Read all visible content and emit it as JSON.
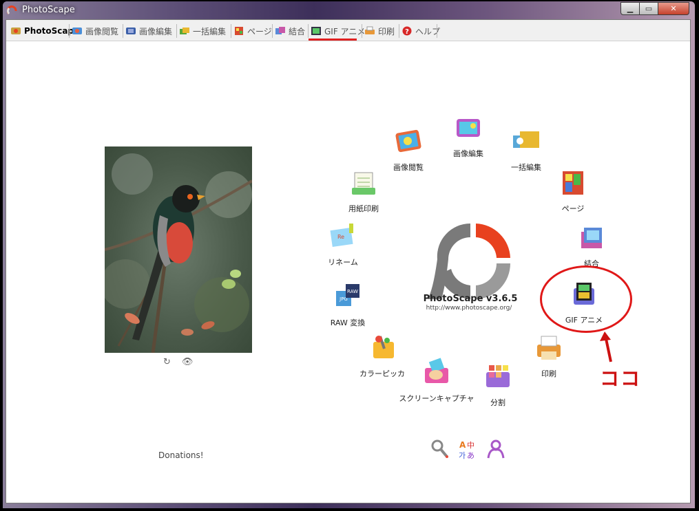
{
  "window": {
    "title": "PhotoScape",
    "close_label": "✕",
    "min_label": "▁",
    "max_label": "▭"
  },
  "tabs": [
    {
      "label": "PhotoScape",
      "icon": "photoscape-icon"
    },
    {
      "label": "画像閲覧",
      "icon": "viewer-icon"
    },
    {
      "label": "画像編集",
      "icon": "editor-icon"
    },
    {
      "label": "一括編集",
      "icon": "batch-icon"
    },
    {
      "label": "ページ",
      "icon": "page-icon"
    },
    {
      "label": "結合",
      "icon": "combine-icon"
    },
    {
      "label": "GIF アニメ",
      "icon": "gif-icon"
    },
    {
      "label": "印刷",
      "icon": "print-icon"
    },
    {
      "label": "ヘルプ",
      "icon": "help-icon"
    }
  ],
  "main": {
    "version": "PhotoScape v3.6.5",
    "url": "http://www.photoscape.org/",
    "donations": "Donations!",
    "photo_tools": [
      "↻",
      "👁"
    ]
  },
  "launcher": {
    "viewer": "画像閲覧",
    "editor": "画像編集",
    "batch": "一括編集",
    "page": "ページ",
    "combine": "結合",
    "gif": "GIF アニメ",
    "print": "印刷",
    "splitter": "分割",
    "screen_capture": "スクリーンキャプチャ",
    "color_picker": "カラーピッカ",
    "raw": "RAW 変換",
    "rename": "リネーム",
    "paper_print": "用紙印刷"
  },
  "annotation": {
    "text": "ココ",
    "color": "#cc1111"
  },
  "colors": {
    "accent": "#e8411f",
    "logo_gray": "#7a7a7a",
    "highlight": "#e01818"
  }
}
